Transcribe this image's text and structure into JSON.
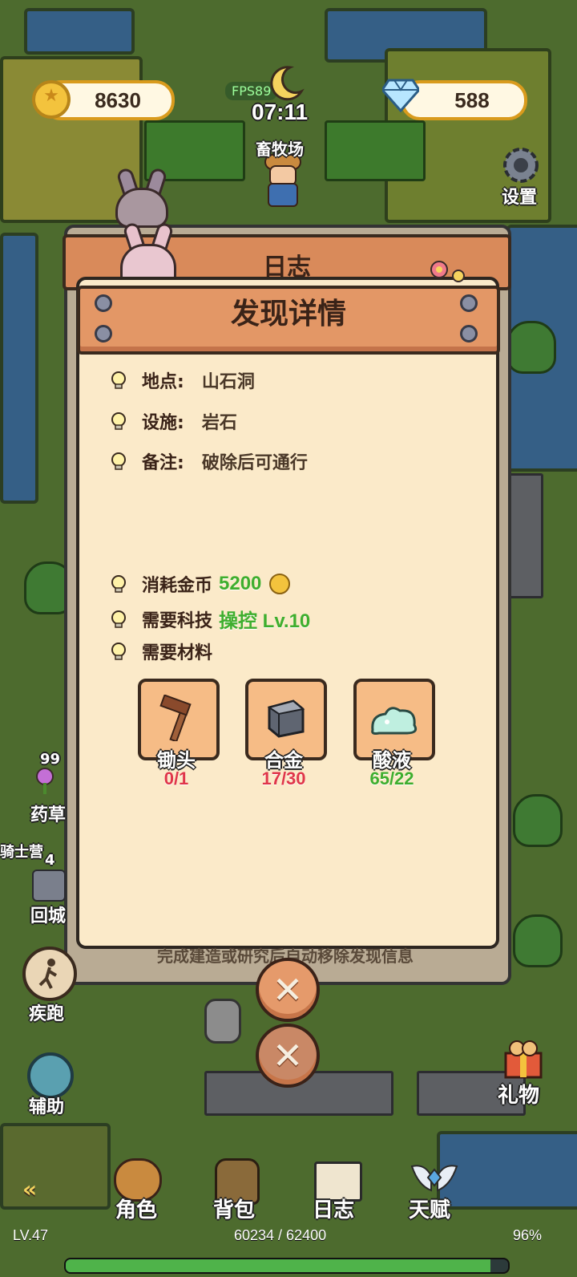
{
  "hud": {
    "coins": "8630",
    "gems": "588",
    "fps": "FPS89",
    "time": "07:11",
    "location": "畜牧场",
    "settings_label": "设置"
  },
  "back_dialog": {
    "title": "日志"
  },
  "dialog": {
    "title": "发现详情",
    "rows": [
      {
        "label": "地点:",
        "value": "山石洞"
      },
      {
        "label": "设施:",
        "value": "岩石"
      },
      {
        "label": "备注:",
        "value": "破除后可通行"
      }
    ],
    "cost_label": "消耗金币",
    "cost_value": "5200",
    "tech_label": "需要科技",
    "tech_value": "操控 Lv.10",
    "materials_label": "需要材料",
    "materials": [
      {
        "name": "锄头",
        "count": "0/1",
        "have": 0,
        "need": 1,
        "status": "insufficient"
      },
      {
        "name": "合金",
        "count": "17/30",
        "have": 17,
        "need": 30,
        "status": "insufficient"
      },
      {
        "name": "酸液",
        "count": "65/22",
        "have": 65,
        "need": 22,
        "status": "sufficient"
      }
    ],
    "footer_note": "完成建造或研究后自动移除发现信息"
  },
  "side_left": {
    "herb_count": "99",
    "herb_label": "药草",
    "return_count": "4",
    "return_label": "回城",
    "knight_label": "骑士营",
    "sprint_label": "疾跑",
    "assist_label": "辅助"
  },
  "side_right": {
    "gift_label": "礼物"
  },
  "bottom_nav": [
    {
      "label": "角色",
      "icon": "character-icon"
    },
    {
      "label": "背包",
      "icon": "backpack-icon"
    },
    {
      "label": "日志",
      "icon": "journal-icon"
    },
    {
      "label": "天赋",
      "icon": "talent-icon"
    }
  ],
  "player": {
    "level": "LV.47",
    "xp_text": "60234 / 62400",
    "xp_percent_text": "96%",
    "xp_fraction": 0.96
  },
  "colors": {
    "insufficient": "#e0364a",
    "sufficient": "#3fae2e",
    "panel_bg": "#fbeac9",
    "board": "#e39766"
  }
}
